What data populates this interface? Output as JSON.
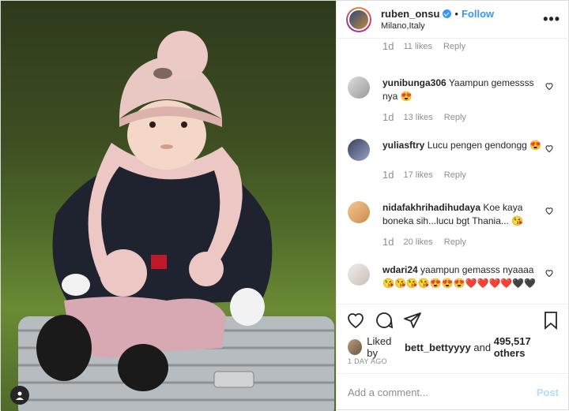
{
  "post": {
    "username": "ruben_onsu",
    "follow_label": "Follow",
    "separator": "•",
    "location": "Milano,Italy",
    "more_label": "•••"
  },
  "comments": [
    {
      "username": "",
      "text": "",
      "age": "1d",
      "likes": "11 likes",
      "reply": "Reply"
    },
    {
      "username": "yunibunga306",
      "text": "Yaampun gemessss nya",
      "emoji": "😍",
      "age": "1d",
      "likes": "13 likes",
      "reply": "Reply"
    },
    {
      "username": "yuliasftry",
      "text": "Lucu pengen gendongg",
      "emoji": "😍",
      "age": "1d",
      "likes": "17 likes",
      "reply": "Reply"
    },
    {
      "username": "nidafakhrihadihudaya",
      "text": "Koe kaya boneka sih...lucu bgt Thania...",
      "emoji": "😘",
      "age": "1d",
      "likes": "20 likes",
      "reply": "Reply"
    },
    {
      "username": "wdari24",
      "text": "yaampun gemasss nyaaaa",
      "emoji": "😘😘😘😘😍😍😍❤️❤️❤️❤️🖤🖤",
      "age": "",
      "likes": "",
      "reply": ""
    }
  ],
  "liked_by": {
    "prefix": "Liked by",
    "user": "bett_bettyyyy",
    "and": "and",
    "count": "495,517 others"
  },
  "date": "1 DAY AGO",
  "add_comment": {
    "placeholder": "Add a comment...",
    "post_label": "Post"
  },
  "colors": {
    "link_blue": "#3897f0",
    "post_disabled": "#b3dbff",
    "meta_gray": "#8e8e8e"
  }
}
